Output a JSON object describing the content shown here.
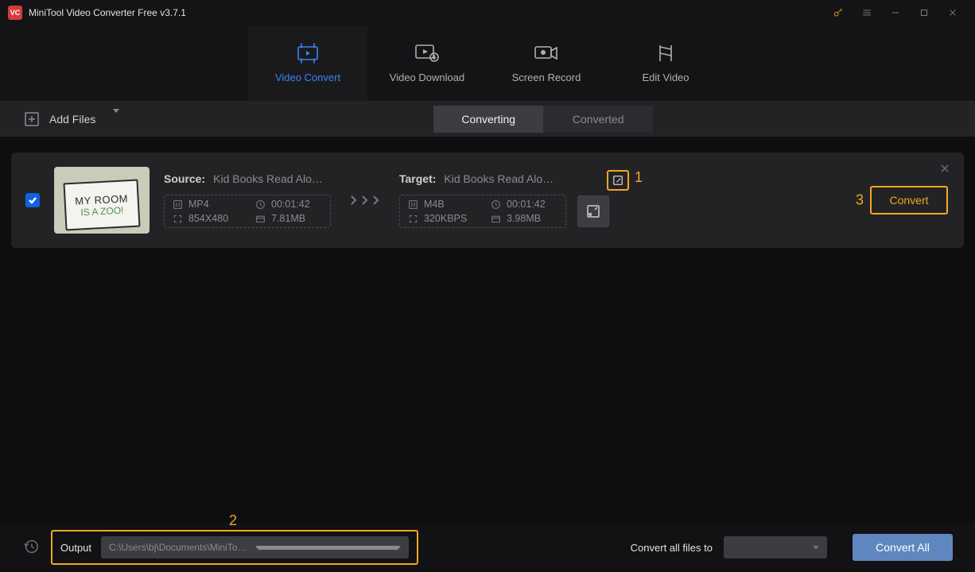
{
  "title": "MiniTool Video Converter Free v3.7.1",
  "nav": {
    "video_convert": "Video Convert",
    "video_download": "Video Download",
    "screen_record": "Screen Record",
    "edit_video": "Edit Video"
  },
  "toolbar": {
    "add_files": "Add Files",
    "tabs": {
      "converting": "Converting",
      "converted": "Converted"
    }
  },
  "file": {
    "source_label": "Source:",
    "source_name": "Kid Books Read Alou...",
    "target_label": "Target:",
    "target_name": "Kid Books Read Alou...",
    "thumb_line1": "MY ROOM",
    "thumb_line2": "IS A ZOO!",
    "src_meta": {
      "format": "MP4",
      "duration": "00:01:42",
      "resolution": "854X480",
      "size": "7.81MB"
    },
    "tgt_meta": {
      "format": "M4B",
      "duration": "00:01:42",
      "bitrate": "320KBPS",
      "size": "3.98MB"
    },
    "convert_label": "Convert"
  },
  "callouts": {
    "one": "1",
    "two": "2",
    "three": "3"
  },
  "bottom": {
    "output_label": "Output",
    "output_path": "C:\\Users\\bj\\Documents\\MiniTool Video Converter\\output",
    "convert_all_label": "Convert all files to",
    "convert_all_btn": "Convert All"
  }
}
